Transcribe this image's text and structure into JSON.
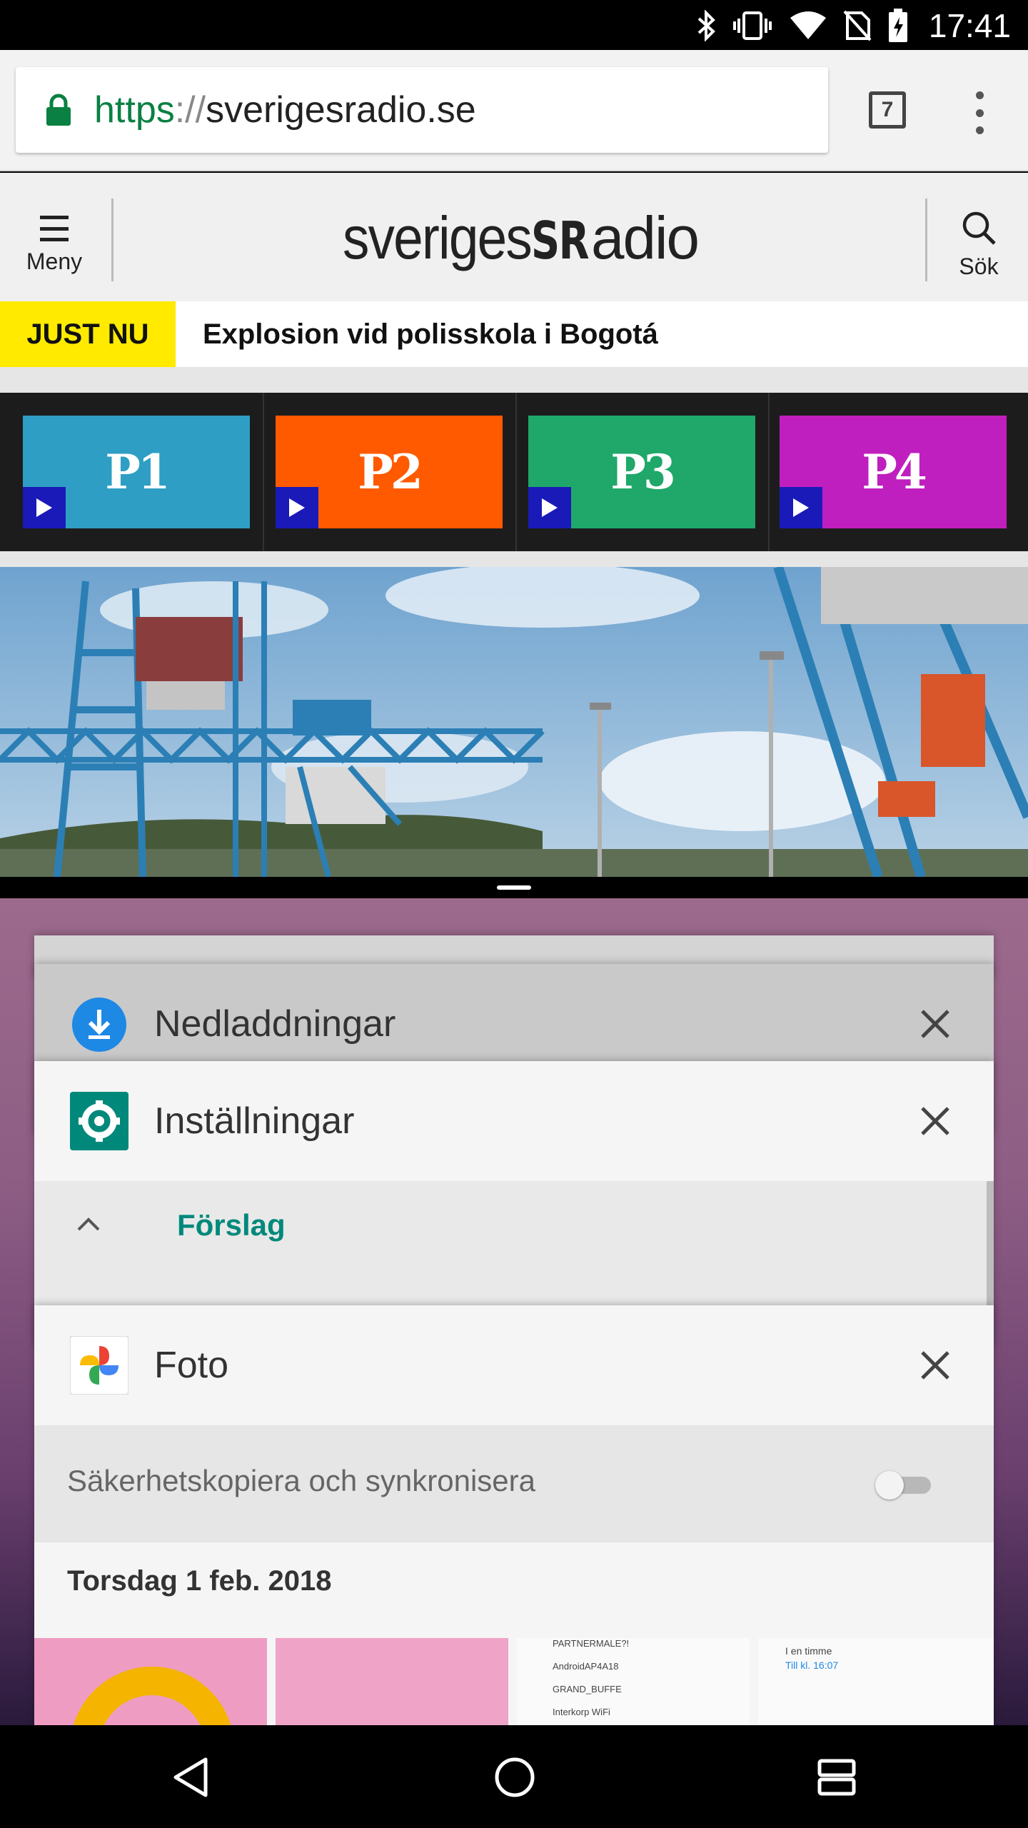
{
  "status_bar": {
    "time": "17:41",
    "icons": [
      "bluetooth-icon",
      "vibrate-icon",
      "wifi-icon",
      "no-sim-icon",
      "battery-charging-icon"
    ]
  },
  "browser": {
    "url_scheme": "https",
    "url_sep": "://",
    "url_host": "sverigesradio.se",
    "tab_count": "7",
    "colors": {
      "secure_green": "#0b8043"
    }
  },
  "site": {
    "menu_label": "Meny",
    "search_label": "Sök",
    "logo_text": "sverigesRadio",
    "breaking": {
      "badge": "JUST NU",
      "headline": "Explosion vid polisskola i Bogotá"
    },
    "channels": [
      {
        "label": "P1",
        "color": "#2e9ec4"
      },
      {
        "label": "P2",
        "color": "#ff5a00"
      },
      {
        "label": "P3",
        "color": "#1fa86a"
      },
      {
        "label": "P4",
        "color": "#c01fbf"
      }
    ],
    "colors": {
      "breaking_yellow": "#ffea00",
      "play_blue": "#1a1ab8"
    }
  },
  "recents": {
    "cards": [
      {
        "title": "Nedladdningar",
        "icon": "download-icon"
      },
      {
        "title": "Inställningar",
        "icon": "settings-gear-icon",
        "content": {
          "section_label": "Förslag"
        }
      },
      {
        "title": "Foto",
        "icon": "google-photos-icon",
        "content": {
          "backup_label": "Säkerhetskopiera och synkronisera",
          "backup_on": false,
          "date_heading": "Torsdag 1 feb. 2018",
          "wifi_list": [
            "PARTNERMALE?!",
            "AndroidAP4A18",
            "GRAND_BUFFE",
            "Interkorp WiFi"
          ],
          "timer_text": "I en timme",
          "timer_sub": "Till kl. 16:07"
        }
      }
    ]
  },
  "nav": {
    "buttons": [
      "back-icon",
      "home-icon",
      "recents-icon"
    ]
  }
}
